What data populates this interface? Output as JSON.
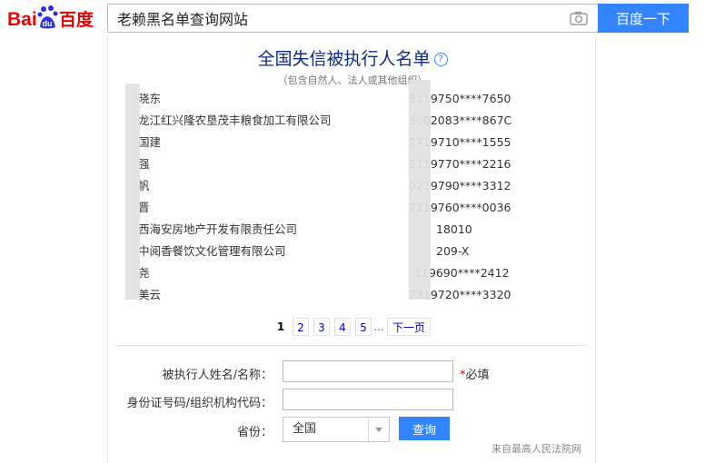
{
  "header": {
    "logo_text_left": "Bai",
    "logo_text_paw": "du",
    "logo_text_right": "百度",
    "query": "老赖黑名单查询网站",
    "search_button": "百度一下"
  },
  "card": {
    "title": "全国失信被执行人名单",
    "help_glyph": "?",
    "subtitle": "（包含自然人、法人或其他组织）",
    "rows": [
      {
        "name": "晓东",
        "id": "3119750****7650"
      },
      {
        "name": "龙江红兴隆农垦茂丰粮食加工有限公司",
        "id": "3002083****867C"
      },
      {
        "name": "国建",
        "id": "2719710****1555"
      },
      {
        "name": "强",
        "id": "2119770****2216"
      },
      {
        "name": "帆",
        "id": "0219790****3312"
      },
      {
        "name": "晋",
        "id": "2219760****0036"
      },
      {
        "name": "西海安房地产开发有限责任公司",
        "id": "18010"
      },
      {
        "name": "中阅香餐饮文化管理有限公司",
        "id": "209-X"
      },
      {
        "name": "尧",
        "id": "119690****2412"
      },
      {
        "name": "美云",
        "id": "2319720****3320"
      }
    ],
    "pager": {
      "pages": [
        "1",
        "2",
        "3",
        "4",
        "5"
      ],
      "ellipsis": "...",
      "next": "下一页"
    },
    "form": {
      "name_label": "被执行人姓名/名称：",
      "name_value": "",
      "required_mark": "*",
      "required_text": "必填",
      "id_label": "身份证号码/组织机构代码：",
      "id_value": "",
      "province_label": "省份：",
      "province_value": "全国",
      "query_button": "查询"
    },
    "source": "来自最高人民法院网"
  },
  "colors": {
    "brand_blue": "#3385ff",
    "baidu_red": "#e10602",
    "title_blue": "#0c2b8e",
    "link_blue": "#0000cc"
  }
}
